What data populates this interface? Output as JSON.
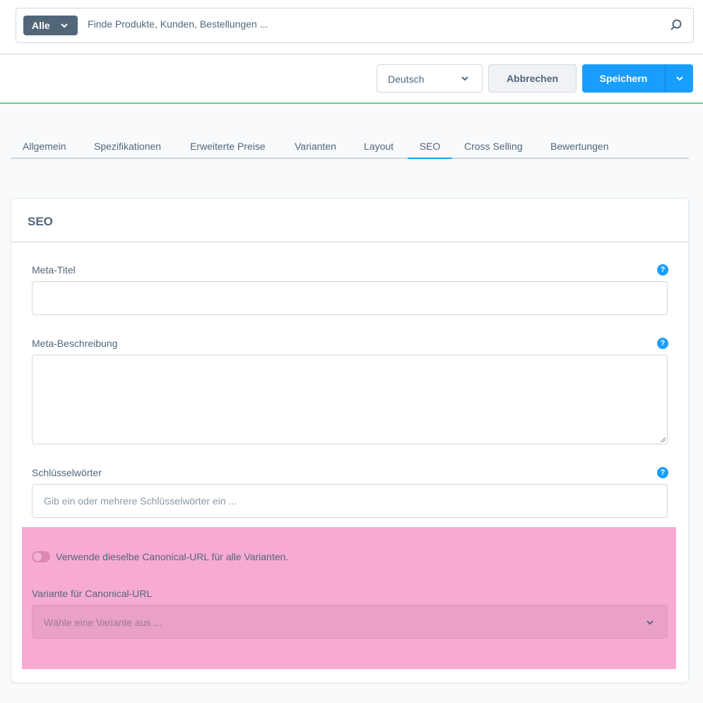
{
  "search": {
    "type_label": "Alle",
    "placeholder": "Finde Produkte, Kunden, Bestellungen ..."
  },
  "actions": {
    "language": "Deutsch",
    "cancel_label": "Abbrechen",
    "save_label": "Speichern"
  },
  "tabs": [
    {
      "label": "Allgemein"
    },
    {
      "label": "Spezifikationen"
    },
    {
      "label": "Erweiterte Preise"
    },
    {
      "label": "Varianten"
    },
    {
      "label": "Layout"
    },
    {
      "label": "SEO",
      "active": true
    },
    {
      "label": "Cross Selling"
    },
    {
      "label": "Bewertungen"
    }
  ],
  "card": {
    "title": "SEO",
    "meta_title_label": "Meta-Titel",
    "meta_title_value": "",
    "meta_description_label": "Meta-Beschreibung",
    "meta_description_value": "",
    "keywords_label": "Schlüsselwörter",
    "keywords_placeholder": "Gib ein oder mehrere Schlüsselwörter ein ...",
    "help_glyph": "?"
  },
  "canonical": {
    "toggle_label": "Verwende dieselbe Canonical-URL für alle Varianten.",
    "toggle_on": false,
    "variant_label": "Variante für Canonical-URL",
    "variant_placeholder": "Wähle eine Variante aus ..."
  },
  "colors": {
    "primary": "#189eff",
    "text": "#52667a",
    "highlight": "#f7abd3",
    "accent_line": "#65cf9a"
  }
}
